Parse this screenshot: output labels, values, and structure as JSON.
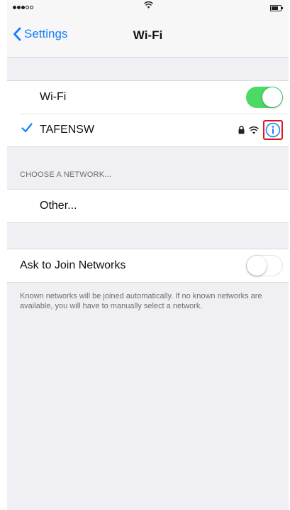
{
  "status_bar": {
    "signal_icon": "signal-dots-icon",
    "wifi_icon": "wifi-icon",
    "battery_icon": "battery-icon"
  },
  "nav": {
    "back_label": "Settings",
    "title": "Wi-Fi",
    "back_icon": "chevron-left-icon"
  },
  "wifi_toggle": {
    "label": "Wi-Fi",
    "state": "on"
  },
  "current_network": {
    "name": "TAFENSW",
    "icons": [
      "checkmark-icon",
      "lock-icon",
      "wifi-icon",
      "info-icon"
    ]
  },
  "choose_network": {
    "header": "CHOOSE A NETWORK...",
    "other_label": "Other..."
  },
  "ask_to_join": {
    "label": "Ask to Join Networks",
    "state": "off",
    "note": "Known networks will be joined automatically. If no known networks are available, you will have to manually select a network."
  },
  "colors": {
    "accent": "#147efb",
    "toggle_on": "#4cd964",
    "highlight": "#d7191c",
    "background": "#efeff4"
  }
}
